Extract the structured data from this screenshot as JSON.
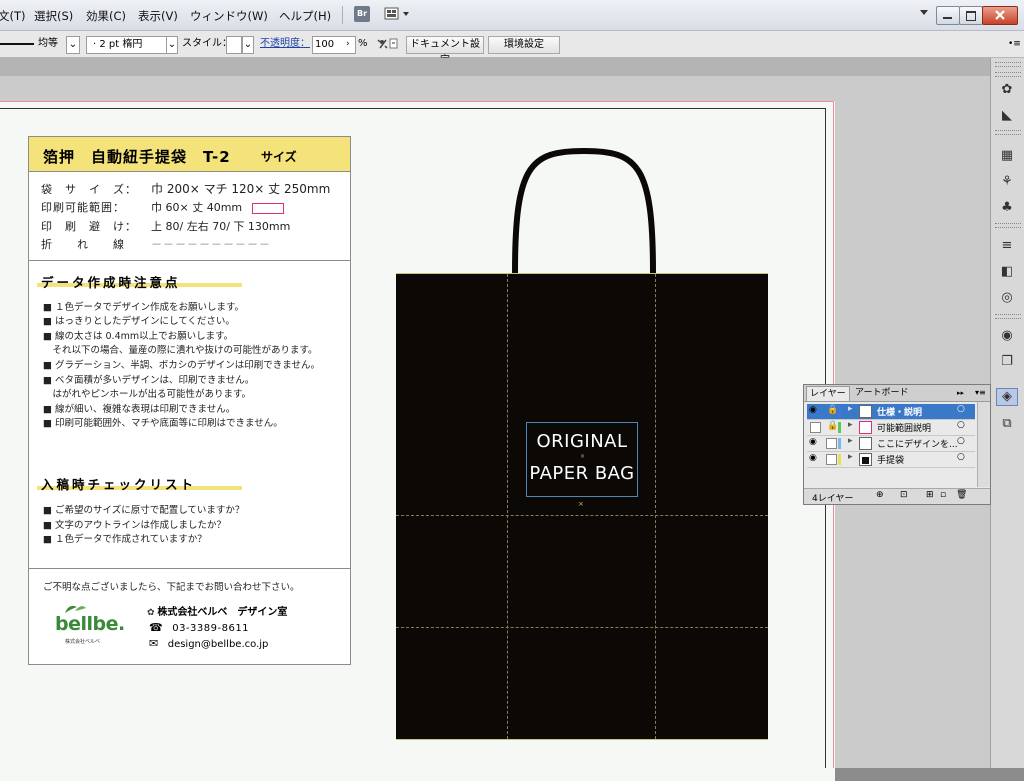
{
  "menu": {
    "items": [
      "文(T)",
      "選択(S)",
      "効果(C)",
      "表示(V)",
      "ウィンドウ(W)",
      "ヘルプ(H)"
    ],
    "br_label": "Br"
  },
  "control_bar": {
    "stroke_style": "均等",
    "stroke_weight": "2 pt 楕円",
    "style_label": "スタイル：",
    "opacity_label": "不透明度：",
    "opacity_value": "100",
    "percent": "%",
    "document_setup": "ドキュメント設定",
    "preferences": "環境設定"
  },
  "spec": {
    "title": "箔押　自動紐手提袋　T-2",
    "title_suffix": "サイズ",
    "rows": [
      {
        "label": "袋　サ　イ　ズ：",
        "value": "巾 200× マチ 120× 丈 250mm"
      },
      {
        "label": "印刷可能範囲：",
        "value": "巾 60× 丈 40mm"
      },
      {
        "label": "印　刷　避　け：",
        "value": "上 80/ 左右 70/ 下 130mm"
      },
      {
        "label": "折　　れ　　線",
        "value": "－－－－－－－－－－"
      }
    ]
  },
  "data_notes": {
    "heading": "データ作成時注意点",
    "items": [
      "■ １色データでデザイン作成をお願いします。",
      "■ はっきりとしたデザインにしてください。",
      "■ 線の太さは 0.4mm以上でお願いします。",
      "　それ以下の場合、量産の際に潰れや抜けの可能性があります。",
      "■ グラデーション、半調、ボカシのデザインは印刷できません。",
      "■ ベタ面積が多いデザインは、印刷できません。",
      "　はがれやピンホールが出る可能性があります。",
      "■ 線が細い、複雑な表現は印刷できません。",
      "■ 印刷可能範囲外、マチや底面等に印刷はできません。"
    ]
  },
  "checklist": {
    "heading": "入稿時チェックリスト",
    "items": [
      "■ ご希望のサイズに原寸で配置していますか？",
      "■ 文字のアウトラインは作成しましたか？",
      "■ １色データで作成されていますか？"
    ]
  },
  "contact": {
    "intro": "ご不明な点ございましたら、下記までお問い合わせ下さい。",
    "logo": "bellbe.",
    "logo_sub": "株式会社ベルベ",
    "company": "株式会社ベルベ　デザイン室",
    "phone": "03-3389-8611",
    "email": "design@bellbe.co.jp"
  },
  "bag": {
    "line1": "ORIGINAL",
    "line2": "PAPER BAG"
  },
  "layers_panel": {
    "tab_layers": "レイヤー",
    "tab_artboards": "アートボード",
    "layers": [
      {
        "name": "仕様・説明",
        "color": "#4a72d8",
        "selected": true
      },
      {
        "name": "可能範囲説明",
        "color": "#5ac85a",
        "selected": false
      },
      {
        "name": "ここにデザインを...",
        "color": "#7ab8e8",
        "selected": false
      },
      {
        "name": "手提袋",
        "color": "#e8e05a",
        "selected": false
      }
    ],
    "footer": "4レイヤー"
  },
  "colors": {
    "accent_yellow": "#f4e27a",
    "bag_black": "#0b0806",
    "bleed_red": "#f08a9a",
    "print_area_pink": "#d8307a",
    "logo_green": "#3a8a3a"
  }
}
